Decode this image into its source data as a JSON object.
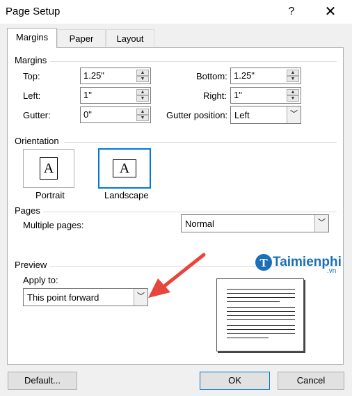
{
  "window": {
    "title": "Page Setup",
    "help_label": "?",
    "close_label": "✕"
  },
  "tabs": [
    {
      "label": "Margins",
      "active": true
    },
    {
      "label": "Paper",
      "active": false
    },
    {
      "label": "Layout",
      "active": false
    }
  ],
  "margins": {
    "section_label": "Margins",
    "top": {
      "label": "Top:",
      "value": "1.25\""
    },
    "left": {
      "label": "Left:",
      "value": "1\""
    },
    "gutter": {
      "label": "Gutter:",
      "value": "0\""
    },
    "bottom": {
      "label": "Bottom:",
      "value": "1.25\""
    },
    "right": {
      "label": "Right:",
      "value": "1\""
    },
    "gutter_position": {
      "label": "Gutter position:",
      "value": "Left"
    }
  },
  "orientation": {
    "section_label": "Orientation",
    "portrait_label": "Portrait",
    "landscape_label": "Landscape",
    "selected": "Landscape",
    "glyph": "A"
  },
  "pages": {
    "section_label": "Pages",
    "multiple_pages_label": "Multiple pages:",
    "multiple_pages_value": "Normal"
  },
  "preview": {
    "section_label": "Preview",
    "apply_to_label": "Apply to:",
    "apply_to_value": "This point forward"
  },
  "watermark": {
    "text": "Taimienphi",
    "suffix": ".vn",
    "color": "#1a6fb5"
  },
  "annotation": {
    "arrow_color": "#e8453c"
  },
  "buttons": {
    "default": "Default...",
    "ok": "OK",
    "cancel": "Cancel"
  },
  "colors": {
    "accent": "#0078d7",
    "dialog_bg": "#f0f0f0",
    "panel_bg": "#ffffff"
  }
}
